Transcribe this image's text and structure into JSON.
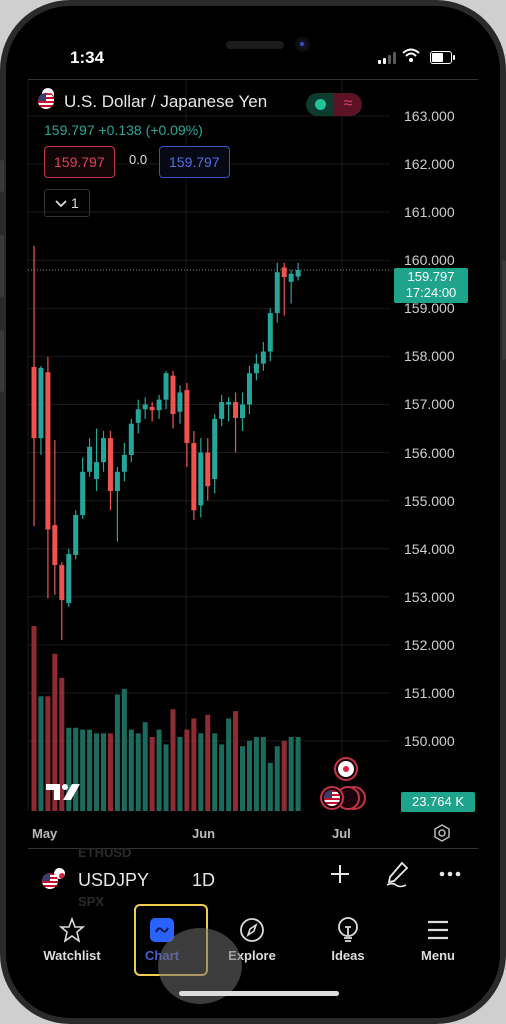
{
  "status_bar": {
    "time": "1:34"
  },
  "header": {
    "title": "U.S. Dollar / Japanese Yen",
    "last_price": "159.797",
    "change": "+0.138",
    "change_pct": "(+0.09%)",
    "sell_price": "159.797",
    "buy_price": "159.797",
    "spread": "0.0",
    "interval_chevron": "⌄",
    "interval_count": "1",
    "toggle_icon": "≈"
  },
  "chart": {
    "last_tag_price": "159.797",
    "last_tag_countdown": "17:24:00",
    "volume_tag": "23.764 K",
    "x_labels": [
      "May",
      "Jun",
      "Jul"
    ],
    "ghost_symbols": [
      "ETHUSD",
      "SPX"
    ]
  },
  "chart_data": {
    "type": "candlestick",
    "title": "U.S. Dollar / Japanese Yen, 1D",
    "xlabel": "",
    "ylabel": "",
    "ylim": [
      149.6,
      163.3
    ],
    "yticks": [
      163,
      162,
      161,
      160,
      159,
      158,
      157,
      156,
      155,
      154,
      153,
      152,
      151,
      150
    ],
    "ytick_labels": [
      "163.000",
      "162.000",
      "161.000",
      "160.000",
      "159.000",
      "158.000",
      "157.000",
      "156.000",
      "155.000",
      "154.000",
      "153.000",
      "152.000",
      "151.000",
      "150.000"
    ],
    "xtick_labels": [
      "May",
      "Jun",
      "Jul"
    ],
    "grid": true,
    "candles": [
      {
        "o": 157.78,
        "h": 160.3,
        "l": 154.47,
        "c": 156.3
      },
      {
        "o": 156.3,
        "h": 157.8,
        "l": 155.95,
        "c": 157.76
      },
      {
        "o": 157.67,
        "h": 157.99,
        "l": 152.97,
        "c": 154.4
      },
      {
        "o": 154.49,
        "h": 156.26,
        "l": 153.04,
        "c": 153.66
      },
      {
        "o": 153.66,
        "h": 153.72,
        "l": 152.1,
        "c": 152.93
      },
      {
        "o": 152.87,
        "h": 154.0,
        "l": 152.79,
        "c": 153.89
      },
      {
        "o": 153.87,
        "h": 154.8,
        "l": 153.78,
        "c": 154.7
      },
      {
        "o": 154.7,
        "h": 155.9,
        "l": 154.62,
        "c": 155.6
      },
      {
        "o": 155.6,
        "h": 156.3,
        "l": 155.5,
        "c": 156.12
      },
      {
        "o": 155.45,
        "h": 156.5,
        "l": 155.2,
        "c": 155.8
      },
      {
        "o": 155.8,
        "h": 156.45,
        "l": 155.6,
        "c": 156.3
      },
      {
        "o": 156.3,
        "h": 156.45,
        "l": 154.8,
        "c": 155.2
      },
      {
        "o": 155.2,
        "h": 155.7,
        "l": 154.15,
        "c": 155.6
      },
      {
        "o": 155.6,
        "h": 156.2,
        "l": 155.4,
        "c": 155.95
      },
      {
        "o": 155.95,
        "h": 156.7,
        "l": 155.8,
        "c": 156.6
      },
      {
        "o": 156.62,
        "h": 157.1,
        "l": 156.4,
        "c": 156.9
      },
      {
        "o": 156.9,
        "h": 157.15,
        "l": 156.7,
        "c": 157.0
      },
      {
        "o": 156.95,
        "h": 157.05,
        "l": 156.65,
        "c": 156.88
      },
      {
        "o": 156.88,
        "h": 157.2,
        "l": 156.7,
        "c": 157.1
      },
      {
        "o": 157.1,
        "h": 157.7,
        "l": 156.9,
        "c": 157.65
      },
      {
        "o": 157.6,
        "h": 157.7,
        "l": 156.5,
        "c": 156.8
      },
      {
        "o": 156.85,
        "h": 157.4,
        "l": 156.6,
        "c": 157.25
      },
      {
        "o": 157.3,
        "h": 157.45,
        "l": 155.7,
        "c": 156.2
      },
      {
        "o": 156.2,
        "h": 156.45,
        "l": 154.6,
        "c": 154.8
      },
      {
        "o": 154.9,
        "h": 156.3,
        "l": 154.65,
        "c": 156.0
      },
      {
        "o": 156.0,
        "h": 156.3,
        "l": 155.0,
        "c": 155.3
      },
      {
        "o": 155.45,
        "h": 156.8,
        "l": 155.15,
        "c": 156.7
      },
      {
        "o": 156.7,
        "h": 157.2,
        "l": 156.55,
        "c": 157.05
      },
      {
        "o": 157.0,
        "h": 157.15,
        "l": 156.65,
        "c": 157.05
      },
      {
        "o": 157.05,
        "h": 157.25,
        "l": 156.0,
        "c": 156.72
      },
      {
        "o": 156.72,
        "h": 157.25,
        "l": 156.45,
        "c": 157.0
      },
      {
        "o": 157.0,
        "h": 157.8,
        "l": 156.8,
        "c": 157.65
      },
      {
        "o": 157.65,
        "h": 158.05,
        "l": 157.5,
        "c": 157.85
      },
      {
        "o": 157.85,
        "h": 158.3,
        "l": 157.7,
        "c": 158.1
      },
      {
        "o": 158.1,
        "h": 159.0,
        "l": 157.9,
        "c": 158.9
      },
      {
        "o": 158.9,
        "h": 159.95,
        "l": 158.7,
        "c": 159.75
      },
      {
        "o": 159.85,
        "h": 159.95,
        "l": 158.85,
        "c": 159.65
      },
      {
        "o": 159.55,
        "h": 159.8,
        "l": 159.1,
        "c": 159.72
      },
      {
        "o": 159.66,
        "h": 159.95,
        "l": 159.58,
        "c": 159.797
      }
    ],
    "volume": {
      "unit": "K",
      "last_value": 23.764,
      "values": [
        100,
        62,
        62,
        85,
        72,
        45,
        45,
        44,
        44,
        42,
        42,
        42,
        63,
        66,
        44,
        42,
        48,
        40,
        44,
        36,
        55,
        40,
        44,
        50,
        42,
        52,
        42,
        36,
        50,
        54,
        35,
        38,
        40,
        40,
        26,
        35,
        38,
        40,
        40
      ]
    },
    "colors": {
      "up": "#26a69a",
      "down": "#ef5350",
      "up_volume": "#1b6b5e",
      "down_volume": "#8f2b33",
      "background": "#000000",
      "grid": "#1a1a1a"
    }
  },
  "symbol_bar": {
    "symbol": "USDJPY",
    "timeframe": "1D",
    "add_icon": "+",
    "draw_icon": "pen",
    "more_icon": "•••"
  },
  "nav": {
    "items": [
      {
        "label": "Watchlist",
        "icon": "star-icon"
      },
      {
        "label": "Chart",
        "icon": "chart-icon",
        "active": true
      },
      {
        "label": "Explore",
        "icon": "compass-icon"
      },
      {
        "label": "Ideas",
        "icon": "lightbulb-icon"
      },
      {
        "label": "Menu",
        "icon": "menu-icon"
      }
    ]
  },
  "accent": {
    "active_nav": "#2962ff",
    "highlight": "#f2cc4c",
    "tag": "#1fa38b"
  }
}
